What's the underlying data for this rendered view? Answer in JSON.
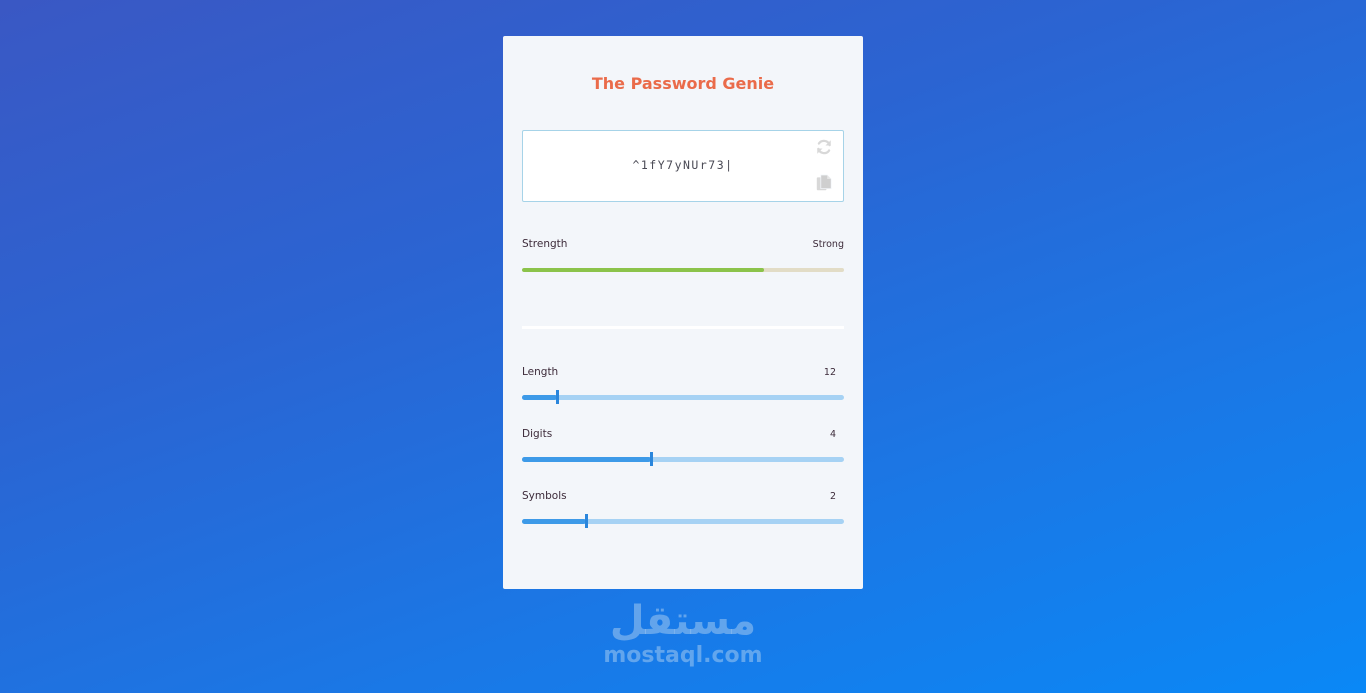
{
  "app": {
    "title": "The Password Genie"
  },
  "password": {
    "value": "^1fY7yNUr73|"
  },
  "strength": {
    "label": "Strength",
    "value_text": "Strong",
    "level": 0.75,
    "fill_color": "#8bc34a",
    "track_color": "#e2dcc6"
  },
  "sliders": [
    {
      "label": "Length",
      "value": "12",
      "position": 0.11
    },
    {
      "label": "Digits",
      "value": "4",
      "position": 0.4
    },
    {
      "label": "Symbols",
      "value": "2",
      "position": 0.2
    }
  ],
  "icons": {
    "refresh": "refresh-icon",
    "copy": "copy-icon"
  },
  "watermark": {
    "arabic": "مستقل",
    "latin": "mostaql.com"
  },
  "colors": {
    "title": "#ea6b4a",
    "accent": "#3d9ae8"
  }
}
